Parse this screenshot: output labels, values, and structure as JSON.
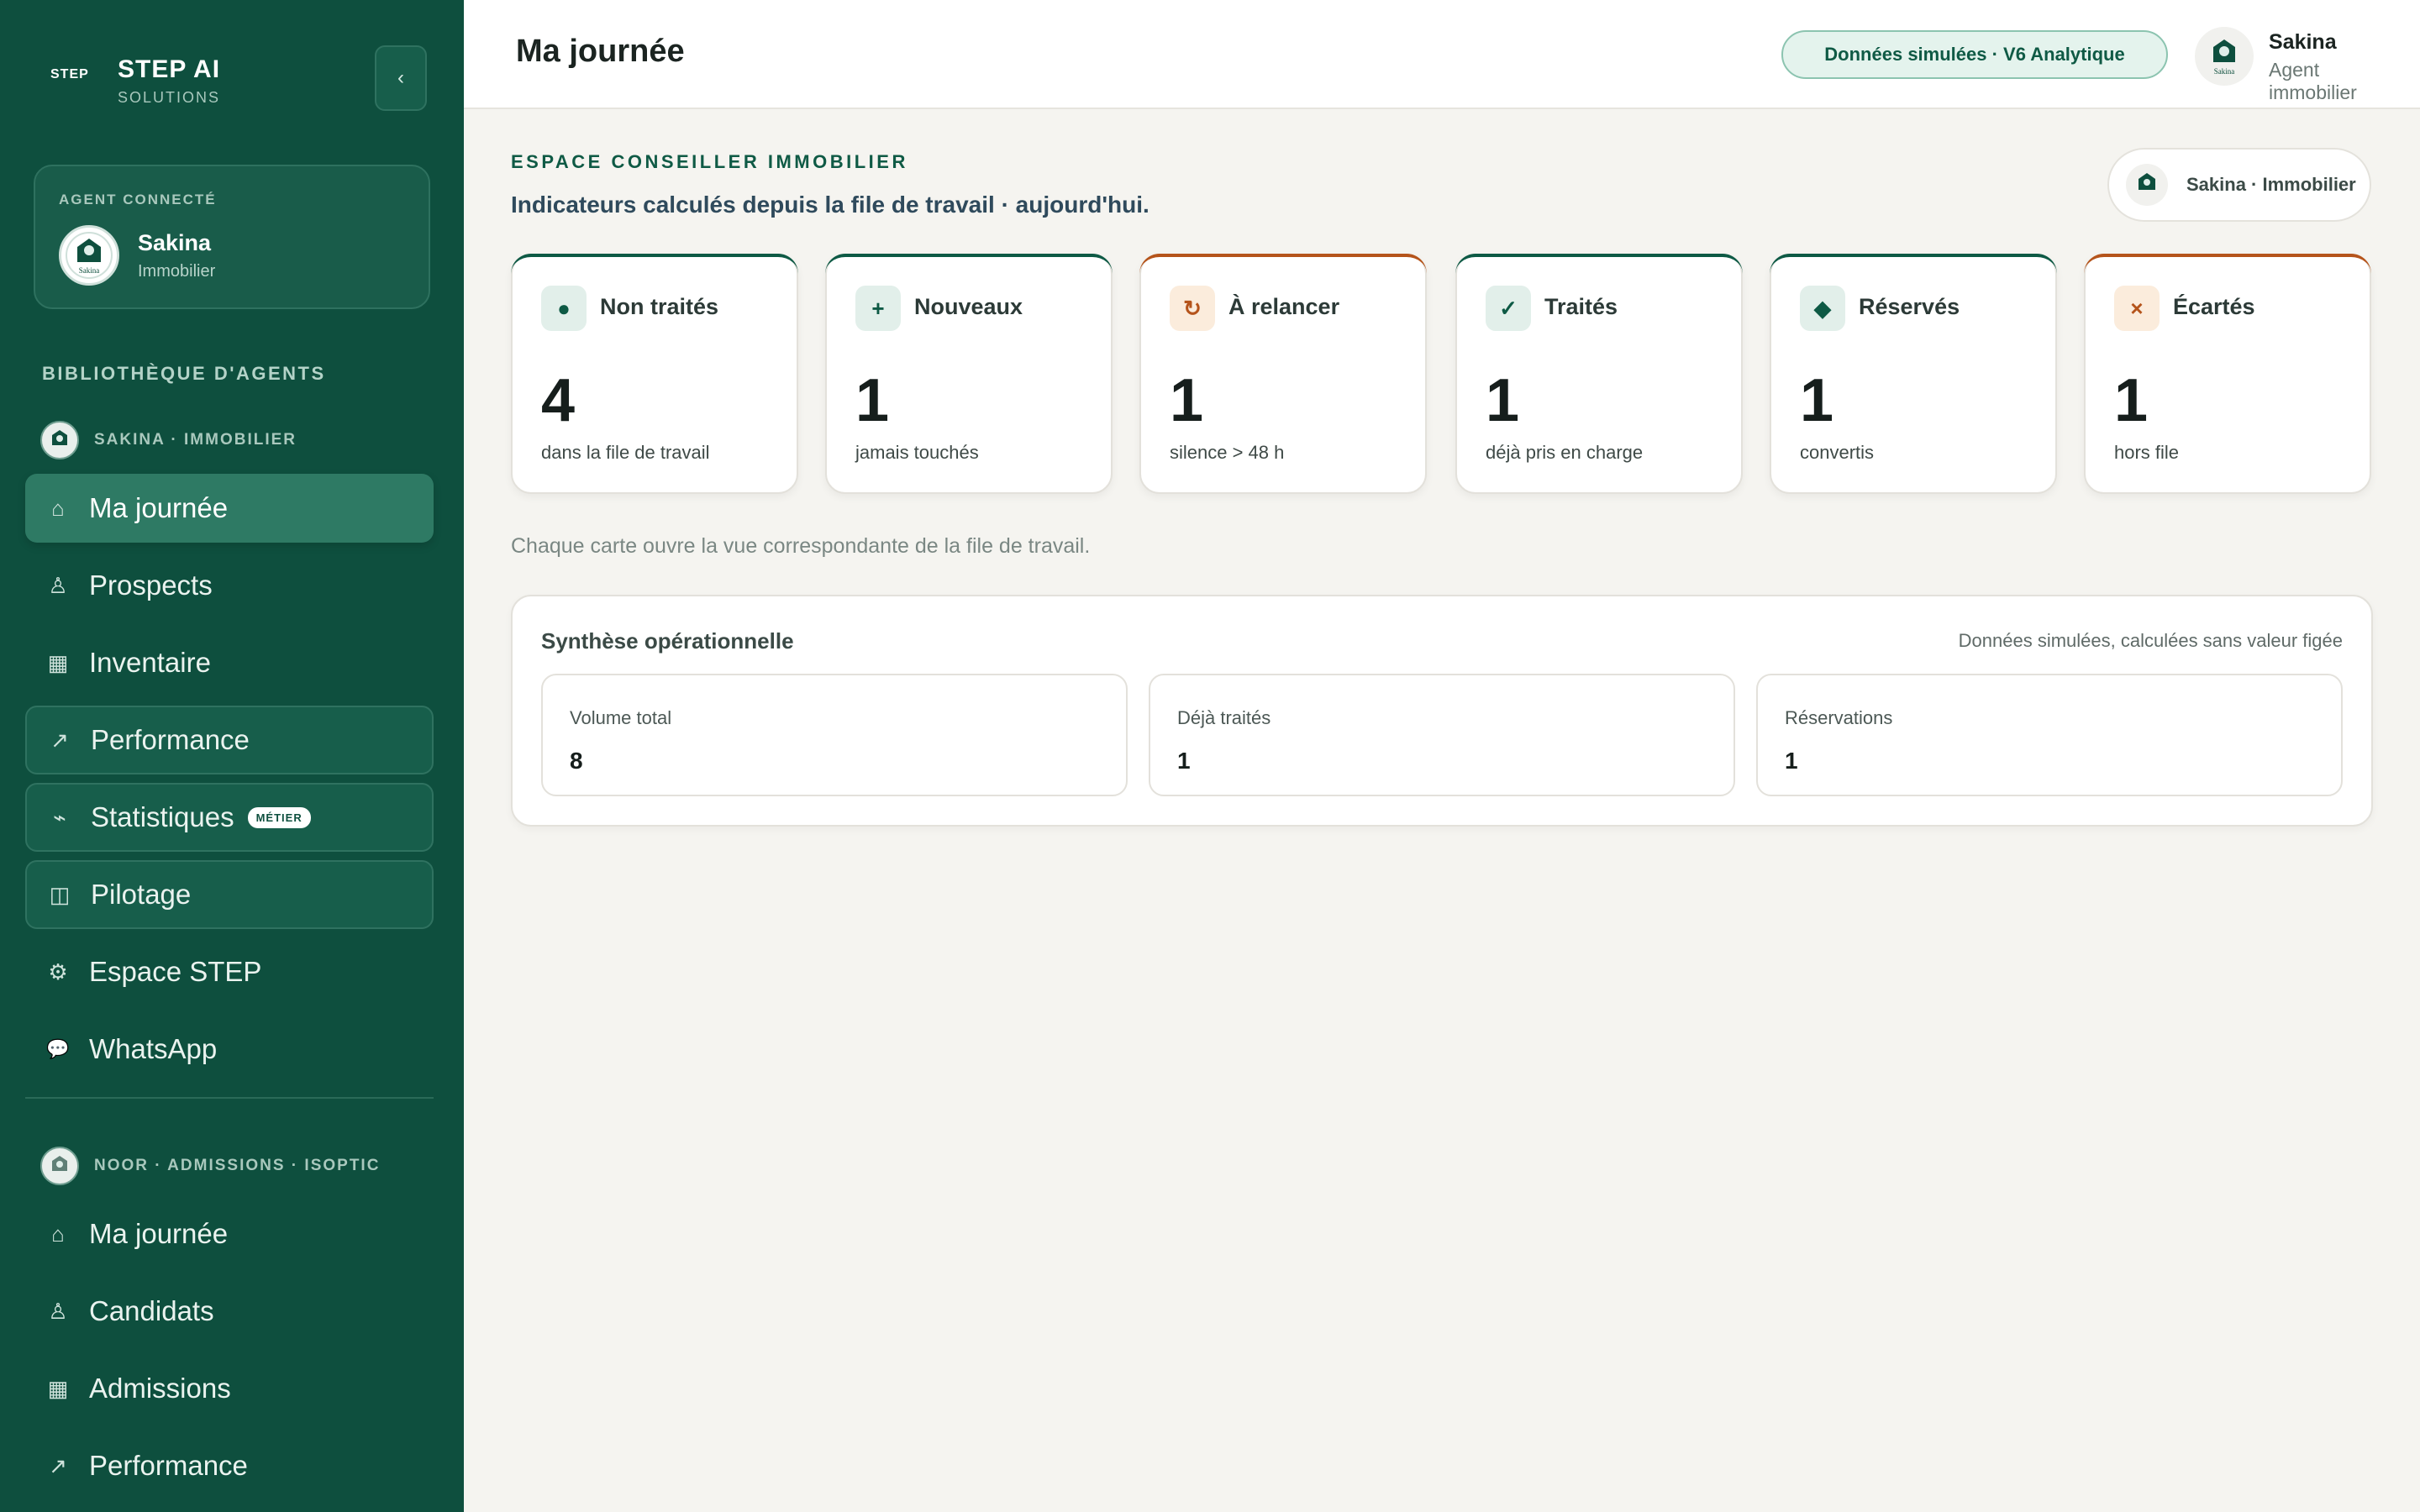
{
  "brand": {
    "logo": "STEP",
    "name": "STEP AI",
    "sub": "SOLUTIONS"
  },
  "sidebar": {
    "collapse_label": "‹",
    "agent_card": {
      "kicker": "AGENT CONNECTÉ",
      "name": "Sakina",
      "role": "Immobilier",
      "avatar_text": "Sakina"
    },
    "library_title": "BIBLIOTHÈQUE D'AGENTS",
    "groups": [
      {
        "label": "SAKINA · IMMOBILIER",
        "items": [
          {
            "icon": "⌂",
            "icon_name": "home-icon",
            "label": "Ma journée",
            "active": true
          },
          {
            "icon": "♙",
            "icon_name": "person-icon",
            "label": "Prospects"
          },
          {
            "icon": "▦",
            "icon_name": "grid-icon",
            "label": "Inventaire"
          },
          {
            "icon": "↗",
            "icon_name": "trend-icon",
            "label": "Performance"
          },
          {
            "icon": "⌁",
            "icon_name": "wave-icon",
            "label": "Statistiques",
            "badge": "MÉTIER"
          },
          {
            "icon": "◫",
            "icon_name": "panel-icon",
            "label": "Pilotage"
          },
          {
            "icon": "⚙",
            "icon_name": "gear-icon",
            "label": "Espace STEP"
          },
          {
            "icon": "💬",
            "icon_name": "chat-icon",
            "label": "WhatsApp"
          }
        ]
      },
      {
        "label": "NOOR · ADMISSIONS · ISOPTIC",
        "items": [
          {
            "icon": "⌂",
            "icon_name": "home-icon",
            "label": "Ma journée"
          },
          {
            "icon": "♙",
            "icon_name": "person-icon",
            "label": "Candidats"
          },
          {
            "icon": "▦",
            "icon_name": "grid-icon",
            "label": "Admissions"
          },
          {
            "icon": "↗",
            "icon_name": "trend-icon",
            "label": "Performance"
          }
        ]
      }
    ]
  },
  "header": {
    "title": "Ma journée",
    "sim_badge": "Données simulées · V6 Analytique",
    "user": {
      "name": "Sakina",
      "role": "Agent immobilier",
      "avatar_text": "Sakina"
    }
  },
  "main": {
    "kicker": "ESPACE CONSEILLER IMMOBILIER",
    "subtitle": "Indicateurs calculés depuis la file de travail · aujourd'hui.",
    "agent_chip": "Sakina · Immobilier",
    "kpis": [
      {
        "icon": "●",
        "icon_name": "dot-icon",
        "label": "Non traités",
        "value": "4",
        "caption": "dans la file de travail",
        "accent": "#0e5a45"
      },
      {
        "icon": "+",
        "icon_name": "plus-icon",
        "label": "Nouveaux",
        "value": "1",
        "caption": "jamais touchés",
        "accent": "#0e5a45"
      },
      {
        "icon": "↻",
        "icon_name": "refresh-icon",
        "label": "À relancer",
        "value": "1",
        "caption": "silence > 48 h",
        "accent": "#b5541b"
      },
      {
        "icon": "✓",
        "icon_name": "check-icon",
        "label": "Traités",
        "value": "1",
        "caption": "déjà pris en charge",
        "accent": "#0e5a45"
      },
      {
        "icon": "◆",
        "icon_name": "diamond-icon",
        "label": "Réservés",
        "value": "1",
        "caption": "convertis",
        "accent": "#0e5a45"
      },
      {
        "icon": "×",
        "icon_name": "close-icon",
        "label": "Écartés",
        "value": "1",
        "caption": "hors file",
        "accent": "#b5541b"
      }
    ],
    "hint": "Chaque carte ouvre la vue correspondante de la file de travail.",
    "synthesis": {
      "title": "Synthèse opérationnelle",
      "note": "Données simulées, calculées sans valeur figée",
      "stats": [
        {
          "label": "Volume total",
          "value": "8"
        },
        {
          "label": "Déjà traités",
          "value": "1"
        },
        {
          "label": "Réservations",
          "value": "1"
        }
      ]
    }
  },
  "colors": {
    "sidebar": "#0e4f3e",
    "accent": "#0e5a45",
    "warning": "#b5541b",
    "background": "#f5f4f0"
  }
}
